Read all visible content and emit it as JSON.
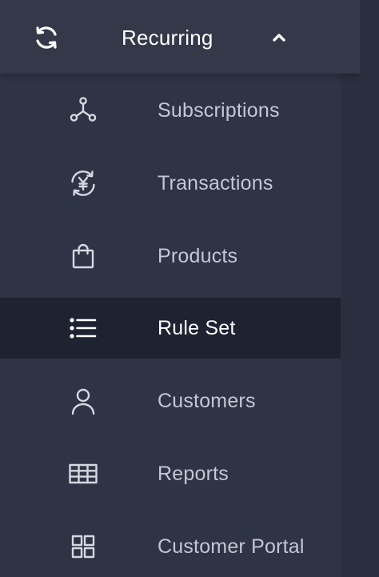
{
  "colors": {
    "sidebar_bg": "#2f3346",
    "header_bg": "#343849",
    "active_bg": "#1f2231",
    "icon": "#d6d8e0",
    "label": "#c4c7d3",
    "label_active": "#ffffff"
  },
  "group": {
    "label": "Recurring",
    "icon": "refresh-icon",
    "state": "expanded",
    "chevron": "chevron-up-icon"
  },
  "items": [
    {
      "label": "Subscriptions",
      "icon": "network-nodes-icon",
      "active": false
    },
    {
      "label": "Transactions",
      "icon": "yen-cycle-icon",
      "active": false
    },
    {
      "label": "Products",
      "icon": "shopping-bag-icon",
      "active": false
    },
    {
      "label": "Rule Set",
      "icon": "list-icon",
      "active": true
    },
    {
      "label": "Customers",
      "icon": "user-icon",
      "active": false
    },
    {
      "label": "Reports",
      "icon": "table-grid-icon",
      "active": false
    },
    {
      "label": "Customer Portal",
      "icon": "dashboard-grid-icon",
      "active": false
    }
  ]
}
